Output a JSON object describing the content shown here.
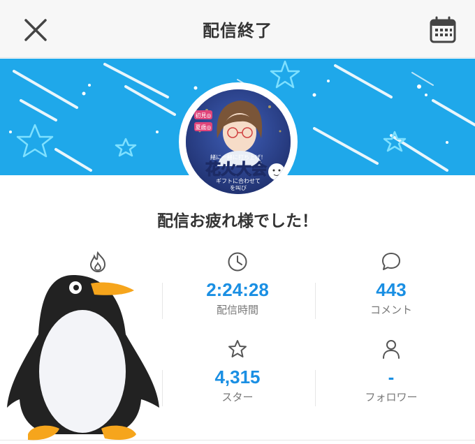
{
  "header": {
    "title": "配信終了",
    "close_icon": "close-x-icon",
    "calendar_icon": "calendar-icon"
  },
  "banner": {
    "color": "#1fa8ea"
  },
  "avatar": {
    "texts": {
      "tag1": "初見◎",
      "tag2": "夏歳◎",
      "line1": "緒に一緒に打ち上げ！",
      "big": "花火大会",
      "line2": "ギフトに合わせて",
      "line3": "を叫び"
    }
  },
  "message": "配信お疲れ様でした！",
  "stats": [
    {
      "icon": "fire-icon",
      "value": "",
      "label": ""
    },
    {
      "icon": "clock-icon",
      "value": "2:24:28",
      "label": "配信時間"
    },
    {
      "icon": "comment-icon",
      "value": "443",
      "label": "コメント"
    },
    {
      "icon": "star-icon",
      "value": "",
      "label": ""
    },
    {
      "icon": "star-icon",
      "value": "4,315",
      "label": "スター"
    },
    {
      "icon": "person-icon",
      "value": "-",
      "label": "フォロワー"
    }
  ],
  "colors": {
    "accent": "#1a8fe3",
    "penguin_body": "#222222",
    "penguin_beak": "#f6a51c"
  }
}
